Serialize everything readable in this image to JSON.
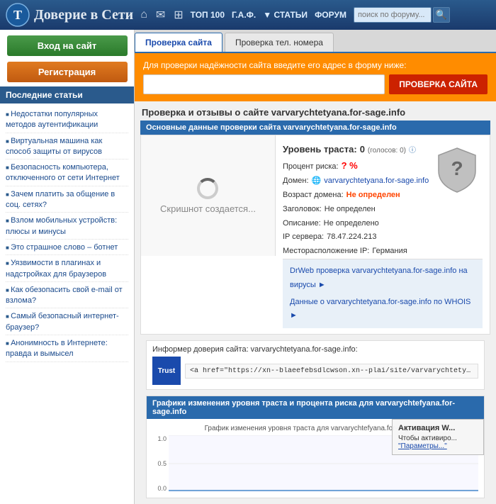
{
  "header": {
    "title": "Доверие в Сети",
    "nav_icons": [
      "home",
      "mail",
      "grid"
    ],
    "nav_links": [
      {
        "label": "ТОП 100",
        "id": "top100"
      },
      {
        "label": "Г.А.Ф.",
        "id": "gaf"
      },
      {
        "label": "▼ СТАТЬИ",
        "id": "articles"
      },
      {
        "label": "ФОРУМ",
        "id": "forum"
      }
    ],
    "search_placeholder": "поиск по форуму..."
  },
  "sidebar": {
    "login_button": "Вход на сайт",
    "register_button": "Регистрация",
    "articles_title": "Последние статьи",
    "articles": [
      "Недостатки популярных методов аутентификации",
      "Виртуальная машина как способ защиты от вирусов",
      "Безопасность компьютера, отключенного от сети Интернет",
      "Зачем платить за общение в соц. сетях?",
      "Взлом мобильных устройств: плюсы и минусы",
      "Это страшное слово – ботнет",
      "Уязвимости в плагинах и надстройках для браузеров",
      "Как обезопасить свой e-mail от взлома?",
      "Самый безопасный интернет-браузер?",
      "Анонимность в Интернете: правда и вымысел"
    ]
  },
  "tabs": [
    {
      "label": "Проверка сайта",
      "active": true
    },
    {
      "label": "Проверка тел. номера",
      "active": false
    }
  ],
  "check_form": {
    "label": "Для проверки надёжности сайта введите его адрес в форму ниже:",
    "placeholder": "",
    "button": "ПРОВЕРКА САЙТА"
  },
  "review": {
    "title": "Проверка и отзывы о сайте varvarychtetyana.for-sage.info",
    "section_header": "Основные данные проверки сайта varvarychtetyana.for-sage.info",
    "screenshot_text": "Скришнот создается...",
    "trust_level_label": "Уровень траста:",
    "trust_level_value": "0",
    "trust_votes_label": "(голосов: 0)",
    "percent_label": "Процент риска:",
    "percent_value": "? %",
    "domain_label": "Домен:",
    "domain_value": "varvarychtetyana.for-sage.info",
    "age_label": "Возраст домена:",
    "age_value": "Не определен",
    "header_label": "Заголовок:",
    "header_value": "Не определен",
    "description_label": "Описание:",
    "description_value": "Не определено",
    "ip_label": "IP сервера:",
    "ip_value": "78.47.224.213",
    "location_label": "Месторасположение IP:",
    "location_value": "Германия",
    "link_virus": "DrWeb проверка varvarychtetyana.for-sage.info на вирусы",
    "link_whois": "Данные о varvarychtetyana.for-sage.info по WHOIS"
  },
  "informer": {
    "title": "Информер доверия сайта: varvarychtetyana.for-sage.info:",
    "icon_text": "Trust",
    "code": "<a href=\"https://xn--blaeefebsdlcwson.xn--plai/site/varvarychtetyana.for-sage.info\" target=\"_blank\" title=\"уровень доверия сайту\"><img src=\"https://xn-"
  },
  "graph": {
    "header": "Графики изменения уровня траста и процента риска для varvarychtefyana.for-sage.info",
    "subtitle": "График изменения уровня траста для varvarychtefyana.for-sage.info",
    "y_labels": [
      "1.0",
      "0.5",
      "0.0"
    ],
    "line_data": [
      0,
      0,
      0,
      0,
      0,
      0,
      0,
      0,
      0,
      0
    ]
  },
  "windows_activation": {
    "title": "Активация W...",
    "text": "Чтобы активиро...",
    "link": "\"Параметры...\""
  }
}
